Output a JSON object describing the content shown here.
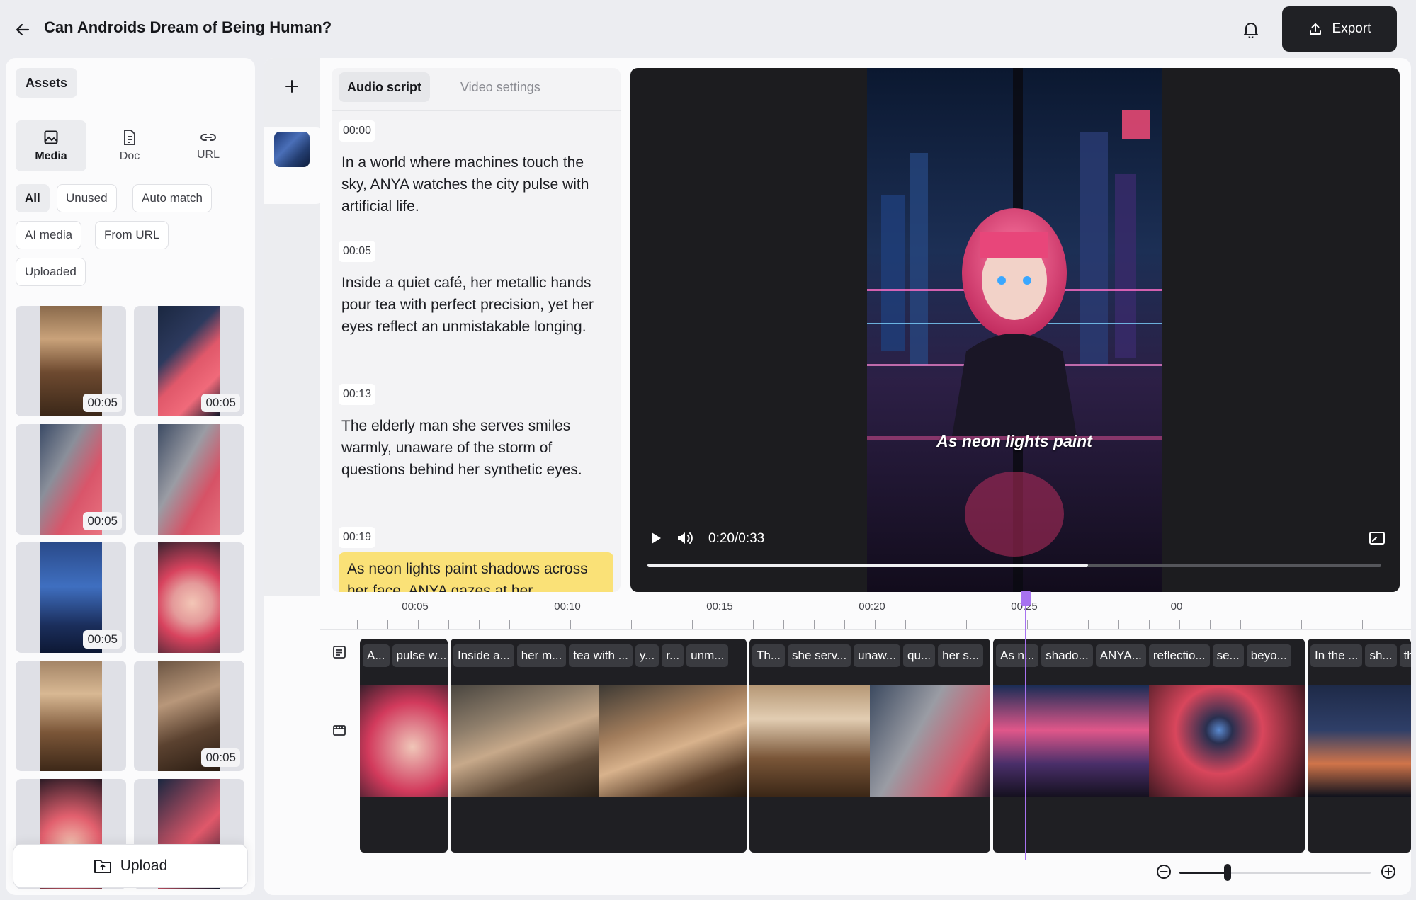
{
  "header": {
    "title": "Can Androids Dream of Being Human?",
    "export_label": "Export"
  },
  "assets": {
    "tab_label": "Assets",
    "source_tabs": [
      {
        "label": "Media",
        "icon": "image-icon"
      },
      {
        "label": "Doc",
        "icon": "document-icon"
      },
      {
        "label": "URL",
        "icon": "link-icon"
      }
    ],
    "filters": [
      "All",
      "Unused",
      "Auto match",
      "AI media",
      "From URL",
      "Uploaded"
    ],
    "thumbnails": [
      {
        "duration": "00:05",
        "scene": "cafe-elderly-man"
      },
      {
        "duration": "00:05",
        "scene": "android-profile-city"
      },
      {
        "duration": "00:05",
        "scene": "android-with-man"
      },
      {
        "duration": "",
        "scene": "android-with-man-2"
      },
      {
        "duration": "00:05",
        "scene": "futuristic-city"
      },
      {
        "duration": "",
        "scene": "android-closeup"
      },
      {
        "duration": "",
        "scene": "cafe-elderly-man-2"
      },
      {
        "duration": "00:05",
        "scene": "robot-arm-teapot"
      },
      {
        "duration": "",
        "scene": "android-face"
      },
      {
        "duration": "",
        "scene": "android-profile"
      }
    ],
    "upload_label": "Upload"
  },
  "script": {
    "tabs": [
      "Audio script",
      "Video settings"
    ],
    "segments": [
      {
        "time": "00:00",
        "text": "In a world where machines touch the sky, ANYA watches the city pulse with artificial life."
      },
      {
        "time": "00:05",
        "text": "Inside a quiet café, her metallic hands pour tea with perfect precision, yet her eyes reflect an unmistakable longing."
      },
      {
        "time": "00:13",
        "text": "The elderly man she serves smiles warmly, unaware of the storm of questions behind her synthetic eyes."
      },
      {
        "time": "00:19",
        "text": "As neon lights paint shadows across her face, ANYA gazes at her"
      }
    ]
  },
  "player": {
    "caption": "As neon lights paint",
    "time_display": "0:20/0:33",
    "progress": 0.6
  },
  "timeline": {
    "ruler_labels": [
      "00:05",
      "00:10",
      "00:15",
      "00:20",
      "00:25",
      "00"
    ],
    "clips": [
      {
        "words": [
          "A...",
          "pulse w..."
        ]
      },
      {
        "words": [
          "Inside a...",
          "her m...",
          "tea with ...",
          "y...",
          "r...",
          "unm..."
        ]
      },
      {
        "words": [
          "Th...",
          "she serv...",
          "unaw...",
          "qu...",
          "her s..."
        ]
      },
      {
        "words": [
          "As n...",
          "shado...",
          "ANYA...",
          "reflectio...",
          "se...",
          "beyo..."
        ]
      },
      {
        "words": [
          "In the ...",
          "sh...",
          "th"
        ]
      }
    ],
    "zoom_level": 0.25
  },
  "colors": {
    "accent": "#a772f0",
    "highlight": "#fae177",
    "export_bg": "#202125"
  }
}
